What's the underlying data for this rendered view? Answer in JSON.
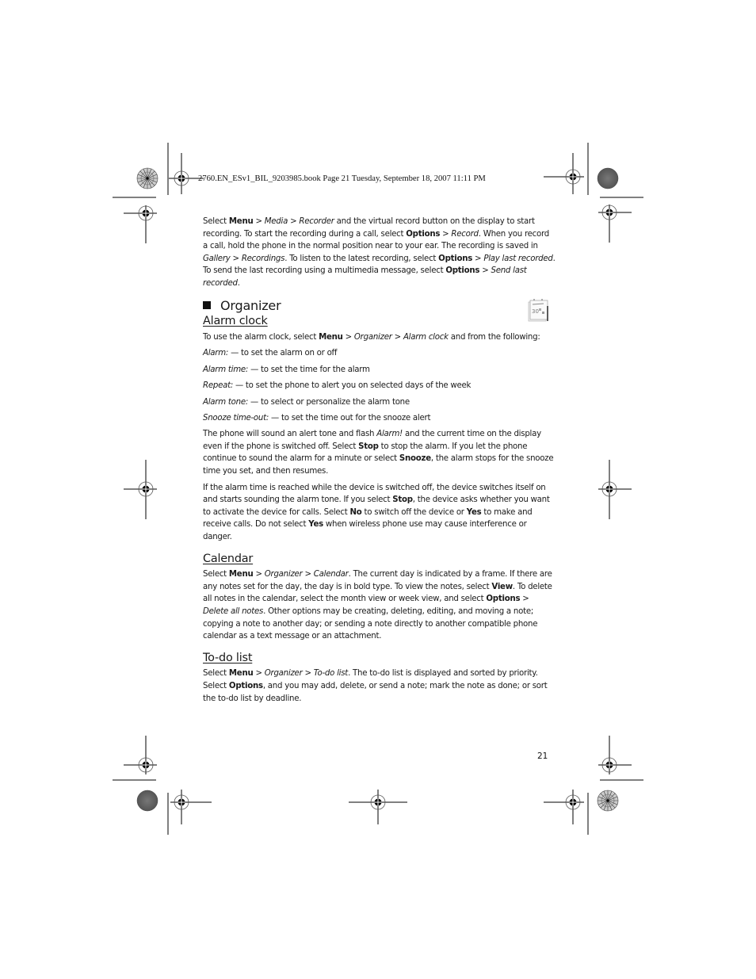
{
  "header": {
    "book_line": "2760.EN_ESv1_BIL_9203985.book  Page 21  Tuesday, September 18, 2007  11:11 PM"
  },
  "intro": {
    "p1": [
      {
        "t": "Select ",
        "s": "n"
      },
      {
        "t": "Menu",
        "s": "b"
      },
      {
        "t": " > ",
        "s": "n"
      },
      {
        "t": "Media",
        "s": "i"
      },
      {
        "t": " > ",
        "s": "n"
      },
      {
        "t": "Recorder",
        "s": "i"
      },
      {
        "t": " and the virtual record button on the display to start recording. To start the recording during a call, select ",
        "s": "n"
      },
      {
        "t": "Options",
        "s": "b"
      },
      {
        "t": " > ",
        "s": "n"
      },
      {
        "t": "Record",
        "s": "i"
      },
      {
        "t": ". When you record a call, hold the phone in the normal position near to your ear. The recording is saved in ",
        "s": "n"
      },
      {
        "t": "Gallery",
        "s": "i"
      },
      {
        "t": " > ",
        "s": "n"
      },
      {
        "t": "Recordings",
        "s": "i"
      },
      {
        "t": ". To listen to the latest recording, select ",
        "s": "n"
      },
      {
        "t": "Options",
        "s": "b"
      },
      {
        "t": " > ",
        "s": "n"
      },
      {
        "t": "Play last recorded",
        "s": "i"
      },
      {
        "t": ". To send the last recording using a multimedia message, select ",
        "s": "n"
      },
      {
        "t": "Options",
        "s": "b"
      },
      {
        "t": " > ",
        "s": "n"
      },
      {
        "t": "Send last recorded",
        "s": "i"
      },
      {
        "t": ".",
        "s": "n"
      }
    ]
  },
  "section": {
    "title": "Organizer",
    "icon": "calendar-icon"
  },
  "alarm_clock": {
    "heading": "Alarm clock",
    "intro": [
      {
        "t": "To use the alarm clock, select ",
        "s": "n"
      },
      {
        "t": "Menu",
        "s": "b"
      },
      {
        "t": " > ",
        "s": "n"
      },
      {
        "t": "Organizer",
        "s": "i"
      },
      {
        "t": " > ",
        "s": "n"
      },
      {
        "t": "Alarm clock",
        "s": "i"
      },
      {
        "t": " and from the following:",
        "s": "n"
      }
    ],
    "items": [
      {
        "term": "Alarm:",
        "desc": " — to set the alarm on or off"
      },
      {
        "term": "Alarm time:",
        "desc": " — to set the time for the alarm"
      },
      {
        "term": "Repeat:",
        "desc": " — to set the phone to alert you on selected days of the week"
      },
      {
        "term": "Alarm tone:",
        "desc": " — to select or personalize the alarm tone"
      },
      {
        "term": "Snooze time-out:",
        "desc": " — to set the time out for the snooze alert"
      }
    ],
    "p2": [
      {
        "t": "The phone will sound an alert tone and flash ",
        "s": "n"
      },
      {
        "t": "Alarm!",
        "s": "i"
      },
      {
        "t": " and the current time on the display even if the phone is switched off. Select ",
        "s": "n"
      },
      {
        "t": "Stop",
        "s": "b"
      },
      {
        "t": " to stop the alarm. If you let the phone continue to sound the alarm for a minute or select ",
        "s": "n"
      },
      {
        "t": "Snooze",
        "s": "b"
      },
      {
        "t": ", the alarm stops for the snooze time you set, and then resumes.",
        "s": "n"
      }
    ],
    "p3": [
      {
        "t": "If the alarm time is reached while the device is switched off, the device switches itself on and starts sounding the alarm tone. If you select ",
        "s": "n"
      },
      {
        "t": "Stop",
        "s": "b"
      },
      {
        "t": ", the device asks whether you want to activate the device for calls. Select ",
        "s": "n"
      },
      {
        "t": "No",
        "s": "b"
      },
      {
        "t": " to switch off the device or ",
        "s": "n"
      },
      {
        "t": "Yes",
        "s": "b"
      },
      {
        "t": " to make and receive calls. Do not select ",
        "s": "n"
      },
      {
        "t": "Yes",
        "s": "b"
      },
      {
        "t": " when wireless phone use may cause interference or danger.",
        "s": "n"
      }
    ]
  },
  "calendar": {
    "heading": "Calendar",
    "p1": [
      {
        "t": "Select ",
        "s": "n"
      },
      {
        "t": "Menu",
        "s": "b"
      },
      {
        "t": " > ",
        "s": "n"
      },
      {
        "t": "Organizer",
        "s": "i"
      },
      {
        "t": " > ",
        "s": "n"
      },
      {
        "t": "Calendar",
        "s": "i"
      },
      {
        "t": ". The current day is indicated by a frame. If there are any notes set for the day, the day is in bold type. To view the notes, select ",
        "s": "n"
      },
      {
        "t": "View",
        "s": "b"
      },
      {
        "t": ". To delete all notes in the calendar, select the month view or week view, and select ",
        "s": "n"
      },
      {
        "t": "Options",
        "s": "b"
      },
      {
        "t": " > ",
        "s": "n"
      },
      {
        "t": "Delete all notes",
        "s": "i"
      },
      {
        "t": ". Other options may be creating, deleting, editing, and moving a note; copying a note to another day; or sending a note directly to another compatible phone calendar as a text message or an attachment.",
        "s": "n"
      }
    ]
  },
  "todo": {
    "heading": "To-do list",
    "p1": [
      {
        "t": "Select ",
        "s": "n"
      },
      {
        "t": "Menu",
        "s": "b"
      },
      {
        "t": " > ",
        "s": "n"
      },
      {
        "t": "Organizer",
        "s": "i"
      },
      {
        "t": " > ",
        "s": "n"
      },
      {
        "t": "To-do list",
        "s": "i"
      },
      {
        "t": ". The to-do list is displayed and sorted by priority. Select ",
        "s": "n"
      },
      {
        "t": "Options",
        "s": "b"
      },
      {
        "t": ", and you may add, delete, or send a note; mark the note as done; or sort the to-do list by deadline.",
        "s": "n"
      }
    ]
  },
  "footer": {
    "page_number": "21"
  }
}
